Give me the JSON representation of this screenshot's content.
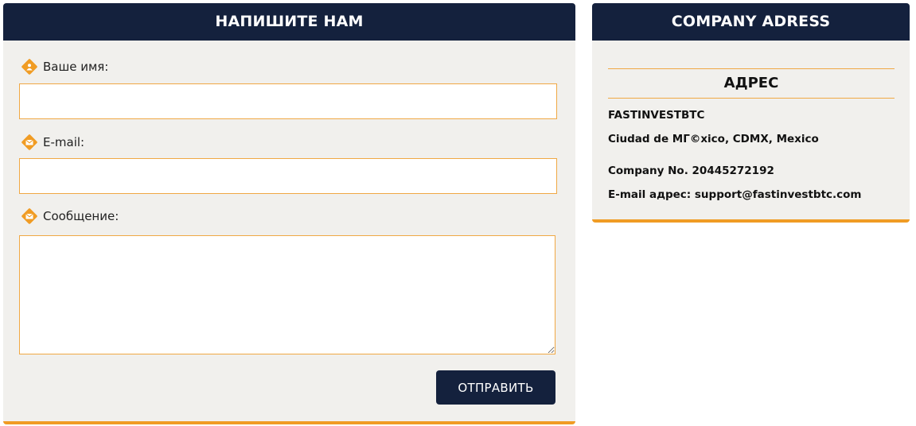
{
  "contact_form": {
    "title": "НАПИШИТЕ НАМ",
    "name_label": "Ваше имя:",
    "name_value": "",
    "email_label": "E-mail:",
    "email_value": "",
    "message_label": "Сообщение:",
    "message_value": "",
    "submit_label": "ОТПРАВИТЬ"
  },
  "company": {
    "title": "COMPANY ADRESS",
    "section_title": "АДРЕС",
    "name": "FASTINVESTBTC",
    "city": "Ciudad de МГ©xico, CDMX, Mexico",
    "company_no": "Company No. 20445272192",
    "email_line": "E-mail адрес: support@fastinvestbtc.com"
  },
  "colors": {
    "header_bg": "#14213d",
    "accent": "#f09c24",
    "panel_bg": "#f1f0ed"
  },
  "icons": {
    "name_field": "user-icon",
    "email_field": "envelope-icon",
    "message_field": "envelope-icon"
  }
}
